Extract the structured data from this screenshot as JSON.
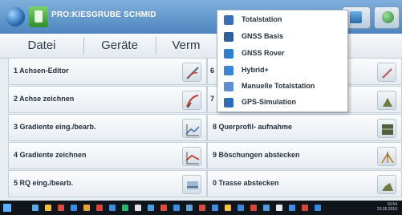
{
  "window": {
    "title": "PRO:KIESGRUBE SCHMID",
    "app_icon": "globe-icon",
    "project_icon": "project-icon"
  },
  "menubar": {
    "items": [
      "Datei",
      "Geräte",
      "Verm"
    ]
  },
  "dropdown": {
    "items": [
      {
        "label": "Totalstation",
        "icon": "totalstation-icon",
        "color": "#3b6fb5"
      },
      {
        "label": "GNSS Basis",
        "icon": "gnss-base-icon",
        "color": "#2f5f9d"
      },
      {
        "label": "GNSS Rover",
        "icon": "gnss-rover-icon",
        "color": "#2f7fd0"
      },
      {
        "label": "Hybrid+",
        "icon": "hybrid-icon",
        "color": "#3a86d6"
      },
      {
        "label": "Manuelle Totalstation",
        "icon": "manual-totalstation-icon",
        "color": "#5b8fd1"
      },
      {
        "label": "GPS-Simulation",
        "icon": "gps-simulation-icon",
        "color": "#2d6cb8"
      }
    ]
  },
  "left_column": [
    {
      "label": "1 Achsen-Editor",
      "icon": "axis-editor-icon"
    },
    {
      "label": "2 Achse zeichnen",
      "icon": "draw-axis-icon"
    },
    {
      "label": "3 Gradiente eing./bearb.",
      "icon": "gradient-edit-icon"
    },
    {
      "label": "4 Gradiente zeichnen",
      "icon": "draw-gradient-icon"
    },
    {
      "label": "5 RQ eing./bearb.",
      "icon": "cross-section-edit-icon"
    }
  ],
  "right_column": [
    {
      "label": "6",
      "icon": "edit-icon"
    },
    {
      "label": "7",
      "icon": "stakeout-icon"
    },
    {
      "label": "8 Querprofil- aufnahme",
      "icon": "cross-profile-icon"
    },
    {
      "label": "9 Böschungen abstecken",
      "icon": "slope-stakeout-icon"
    },
    {
      "label": "0 Trasse abstecken",
      "icon": "route-stakeout-icon"
    }
  ],
  "taskbar": {
    "time": "16:54",
    "date": "23.05.2016"
  },
  "colors": {
    "titlebar": "#4e86bf",
    "accent": "#3b6fb5"
  }
}
